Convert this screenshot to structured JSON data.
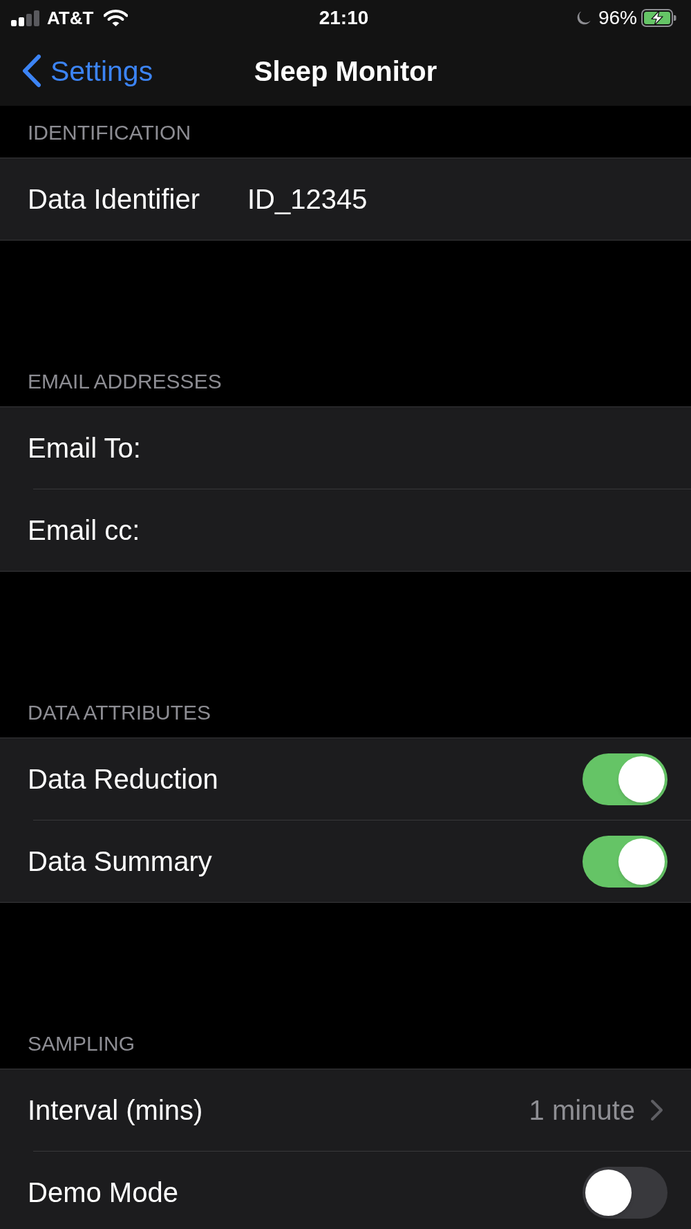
{
  "status_bar": {
    "carrier": "AT&T",
    "time": "21:10",
    "battery": "96%"
  },
  "nav_bar": {
    "back": "Settings",
    "title": "Sleep Monitor"
  },
  "sections": [
    {
      "header": "IDENTIFICATION",
      "rows": [
        {
          "kind": "field",
          "label": "Data Identifier",
          "value": "ID_12345"
        }
      ]
    },
    {
      "header": "EMAIL ADDRESSES",
      "rows": [
        {
          "kind": "field",
          "label": "Email To:"
        },
        {
          "kind": "field",
          "label": "Email cc:"
        }
      ]
    },
    {
      "header": "DATA ATTRIBUTES",
      "rows": [
        {
          "kind": "toggle",
          "label": "Data Reduction",
          "on": true
        },
        {
          "kind": "toggle",
          "label": "Data Summary",
          "on": true
        }
      ]
    },
    {
      "header": "SAMPLING",
      "rows": [
        {
          "kind": "disclosure",
          "label": "Interval (mins)",
          "value": "1 minute"
        },
        {
          "kind": "toggle",
          "label": "Demo Mode",
          "on": false
        }
      ]
    }
  ]
}
